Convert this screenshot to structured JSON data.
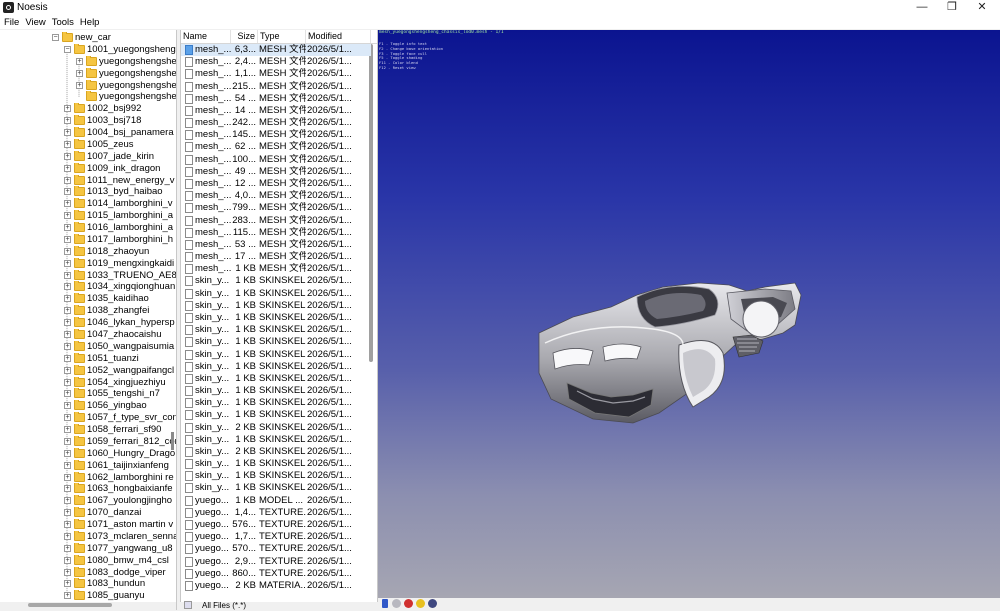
{
  "window": {
    "title": "Noesis",
    "minimize": "—",
    "maximize": "❐",
    "close": "✕"
  },
  "menu": [
    "File",
    "View",
    "Tools",
    "Help"
  ],
  "tree": {
    "items": [
      {
        "label": "new_car",
        "indent": 0,
        "exp": "−"
      },
      {
        "label": "1001_yuegongshengsheng",
        "indent": 1,
        "exp": "−"
      },
      {
        "label": "yuegongshengsheng",
        "indent": 2,
        "exp": "+"
      },
      {
        "label": "yuegongshengsheng",
        "indent": 2,
        "exp": "+"
      },
      {
        "label": "yuegongshengsheng",
        "indent": 2,
        "exp": "+"
      },
      {
        "label": "yuegongshengsheng",
        "indent": 2,
        "exp": ""
      },
      {
        "label": "1002_bsj992",
        "indent": 1,
        "exp": "+"
      },
      {
        "label": "1003_bsj718",
        "indent": 1,
        "exp": "+"
      },
      {
        "label": "1004_bsj_panamera",
        "indent": 1,
        "exp": "+"
      },
      {
        "label": "1005_zeus",
        "indent": 1,
        "exp": "+"
      },
      {
        "label": "1007_jade_kirin",
        "indent": 1,
        "exp": "+"
      },
      {
        "label": "1009_ink_dragon",
        "indent": 1,
        "exp": "+"
      },
      {
        "label": "1011_new_energy_v",
        "indent": 1,
        "exp": "+"
      },
      {
        "label": "1013_byd_haibao",
        "indent": 1,
        "exp": "+"
      },
      {
        "label": "1014_lamborghini_v",
        "indent": 1,
        "exp": "+"
      },
      {
        "label": "1015_lamborghini_a",
        "indent": 1,
        "exp": "+"
      },
      {
        "label": "1016_lamborghini_a",
        "indent": 1,
        "exp": "+"
      },
      {
        "label": "1017_lamborghini_h",
        "indent": 1,
        "exp": "+"
      },
      {
        "label": "1018_zhaoyun",
        "indent": 1,
        "exp": "+"
      },
      {
        "label": "1019_mengxingkaidi",
        "indent": 1,
        "exp": "+"
      },
      {
        "label": "1033_TRUENO_AE86",
        "indent": 1,
        "exp": "+"
      },
      {
        "label": "1034_xingqionghuan",
        "indent": 1,
        "exp": "+"
      },
      {
        "label": "1035_kaidihao",
        "indent": 1,
        "exp": "+"
      },
      {
        "label": "1038_zhangfei",
        "indent": 1,
        "exp": "+"
      },
      {
        "label": "1046_lykan_hypersp",
        "indent": 1,
        "exp": "+"
      },
      {
        "label": "1047_zhaocaishu",
        "indent": 1,
        "exp": "+"
      },
      {
        "label": "1050_wangpaisumia",
        "indent": 1,
        "exp": "+"
      },
      {
        "label": "1051_tuanzi",
        "indent": 1,
        "exp": "+"
      },
      {
        "label": "1052_wangpaifangcl",
        "indent": 1,
        "exp": "+"
      },
      {
        "label": "1054_xingjuezhiyu",
        "indent": 1,
        "exp": "+"
      },
      {
        "label": "1055_tengshi_n7",
        "indent": 1,
        "exp": "+"
      },
      {
        "label": "1056_yingbao",
        "indent": 1,
        "exp": "+"
      },
      {
        "label": "1057_f_type_svr_con",
        "indent": 1,
        "exp": "+"
      },
      {
        "label": "1058_ferrari_sf90",
        "indent": 1,
        "exp": "+"
      },
      {
        "label": "1059_ferrari_812_cor",
        "indent": 1,
        "exp": "+"
      },
      {
        "label": "1060_Hungry_Drago",
        "indent": 1,
        "exp": "+"
      },
      {
        "label": "1061_taijinxianfeng",
        "indent": 1,
        "exp": "+"
      },
      {
        "label": "1062_lamborghini re",
        "indent": 1,
        "exp": "+"
      },
      {
        "label": "1063_hongbaixianfe",
        "indent": 1,
        "exp": "+"
      },
      {
        "label": "1067_youlongjingho",
        "indent": 1,
        "exp": "+"
      },
      {
        "label": "1070_danzai",
        "indent": 1,
        "exp": "+"
      },
      {
        "label": "1071_aston martin v",
        "indent": 1,
        "exp": "+"
      },
      {
        "label": "1073_mclaren_senna",
        "indent": 1,
        "exp": "+"
      },
      {
        "label": "1077_yangwang_u8",
        "indent": 1,
        "exp": "+"
      },
      {
        "label": "1080_bmw_m4_csl",
        "indent": 1,
        "exp": "+"
      },
      {
        "label": "1083_dodge_viper",
        "indent": 1,
        "exp": "+"
      },
      {
        "label": "1083_hundun",
        "indent": 1,
        "exp": "+"
      },
      {
        "label": "1085_guanyu",
        "indent": 1,
        "exp": "+"
      }
    ]
  },
  "files": {
    "columns": {
      "name": "Name",
      "size": "Size",
      "type": "Type",
      "modified": "Modified"
    },
    "rows": [
      {
        "name": "mesh_...",
        "size": "6,3...",
        "type": "MESH 文件",
        "modified": "2026/5/1..."
      },
      {
        "name": "mesh_...",
        "size": "2,4...",
        "type": "MESH 文件",
        "modified": "2026/5/1..."
      },
      {
        "name": "mesh_...",
        "size": "1,1...",
        "type": "MESH 文件",
        "modified": "2026/5/1..."
      },
      {
        "name": "mesh_...",
        "size": "215...",
        "type": "MESH 文件",
        "modified": "2026/5/1..."
      },
      {
        "name": "mesh_...",
        "size": "54 ...",
        "type": "MESH 文件",
        "modified": "2026/5/1..."
      },
      {
        "name": "mesh_...",
        "size": "14 ...",
        "type": "MESH 文件",
        "modified": "2026/5/1..."
      },
      {
        "name": "mesh_...",
        "size": "242...",
        "type": "MESH 文件",
        "modified": "2026/5/1..."
      },
      {
        "name": "mesh_...",
        "size": "145...",
        "type": "MESH 文件",
        "modified": "2026/5/1..."
      },
      {
        "name": "mesh_...",
        "size": "62 ...",
        "type": "MESH 文件",
        "modified": "2026/5/1..."
      },
      {
        "name": "mesh_...",
        "size": "100...",
        "type": "MESH 文件",
        "modified": "2026/5/1..."
      },
      {
        "name": "mesh_...",
        "size": "49 ...",
        "type": "MESH 文件",
        "modified": "2026/5/1..."
      },
      {
        "name": "mesh_...",
        "size": "12 ...",
        "type": "MESH 文件",
        "modified": "2026/5/1..."
      },
      {
        "name": "mesh_...",
        "size": "4,0...",
        "type": "MESH 文件",
        "modified": "2026/5/1..."
      },
      {
        "name": "mesh_...",
        "size": "799...",
        "type": "MESH 文件",
        "modified": "2026/5/1..."
      },
      {
        "name": "mesh_...",
        "size": "283...",
        "type": "MESH 文件",
        "modified": "2026/5/1..."
      },
      {
        "name": "mesh_...",
        "size": "115...",
        "type": "MESH 文件",
        "modified": "2026/5/1..."
      },
      {
        "name": "mesh_...",
        "size": "53 ...",
        "type": "MESH 文件",
        "modified": "2026/5/1..."
      },
      {
        "name": "mesh_...",
        "size": "17 ...",
        "type": "MESH 文件",
        "modified": "2026/5/1..."
      },
      {
        "name": "mesh_...",
        "size": "1 KB",
        "type": "MESH 文件",
        "modified": "2026/5/1..."
      },
      {
        "name": "skin_y...",
        "size": "1 KB",
        "type": "SKINSKEL...",
        "modified": "2026/5/1..."
      },
      {
        "name": "skin_y...",
        "size": "1 KB",
        "type": "SKINSKEL...",
        "modified": "2026/5/1..."
      },
      {
        "name": "skin_y...",
        "size": "1 KB",
        "type": "SKINSKEL...",
        "modified": "2026/5/1..."
      },
      {
        "name": "skin_y...",
        "size": "1 KB",
        "type": "SKINSKEL...",
        "modified": "2026/5/1..."
      },
      {
        "name": "skin_y...",
        "size": "1 KB",
        "type": "SKINSKEL...",
        "modified": "2026/5/1..."
      },
      {
        "name": "skin_y...",
        "size": "1 KB",
        "type": "SKINSKEL...",
        "modified": "2026/5/1..."
      },
      {
        "name": "skin_y...",
        "size": "1 KB",
        "type": "SKINSKEL...",
        "modified": "2026/5/1..."
      },
      {
        "name": "skin_y...",
        "size": "1 KB",
        "type": "SKINSKEL...",
        "modified": "2026/5/1..."
      },
      {
        "name": "skin_y...",
        "size": "1 KB",
        "type": "SKINSKEL...",
        "modified": "2026/5/1..."
      },
      {
        "name": "skin_y...",
        "size": "1 KB",
        "type": "SKINSKEL...",
        "modified": "2026/5/1..."
      },
      {
        "name": "skin_y...",
        "size": "1 KB",
        "type": "SKINSKEL...",
        "modified": "2026/5/1..."
      },
      {
        "name": "skin_y...",
        "size": "1 KB",
        "type": "SKINSKEL...",
        "modified": "2026/5/1..."
      },
      {
        "name": "skin_y...",
        "size": "2 KB",
        "type": "SKINSKEL...",
        "modified": "2026/5/1..."
      },
      {
        "name": "skin_y...",
        "size": "1 KB",
        "type": "SKINSKEL...",
        "modified": "2026/5/1..."
      },
      {
        "name": "skin_y...",
        "size": "2 KB",
        "type": "SKINSKEL...",
        "modified": "2026/5/1..."
      },
      {
        "name": "skin_y...",
        "size": "1 KB",
        "type": "SKINSKEL...",
        "modified": "2026/5/1..."
      },
      {
        "name": "skin_y...",
        "size": "1 KB",
        "type": "SKINSKEL...",
        "modified": "2026/5/1..."
      },
      {
        "name": "skin_y...",
        "size": "1 KB",
        "type": "SKINSKEL...",
        "modified": "2026/5/1..."
      },
      {
        "name": "yuego...",
        "size": "1 KB",
        "type": "MODEL ...",
        "modified": "2026/5/1..."
      },
      {
        "name": "yuego...",
        "size": "1,4...",
        "type": "TEXTURE...",
        "modified": "2026/5/1..."
      },
      {
        "name": "yuego...",
        "size": "576...",
        "type": "TEXTURE...",
        "modified": "2026/5/1..."
      },
      {
        "name": "yuego...",
        "size": "1,7...",
        "type": "TEXTURE...",
        "modified": "2026/5/1..."
      },
      {
        "name": "yuego...",
        "size": "570...",
        "type": "TEXTURE...",
        "modified": "2026/5/1..."
      },
      {
        "name": "yuego...",
        "size": "2,9...",
        "type": "TEXTURE...",
        "modified": "2026/5/1..."
      },
      {
        "name": "yuego...",
        "size": "860...",
        "type": "TEXTURE...",
        "modified": "2026/5/1..."
      },
      {
        "name": "yuego...",
        "size": "2 KB",
        "type": "MATERIA...",
        "modified": "2026/5/1..."
      }
    ],
    "filter": "All Files (*.*)"
  },
  "viewport": {
    "info": "mesh_yuegongshengsheng_chassis_lod0.mesh - 1/1",
    "help": [
      "F1 - Toggle info text",
      "F2 - Change base orientation",
      "F3 - Toggle face cull",
      "F5 - Toggle shading",
      "F11 - Color blend",
      "F12 - Reset view"
    ],
    "colors": {
      "top": "#0b1490",
      "bottom": "#a6a6b2",
      "text": "#9fe0a0"
    }
  }
}
